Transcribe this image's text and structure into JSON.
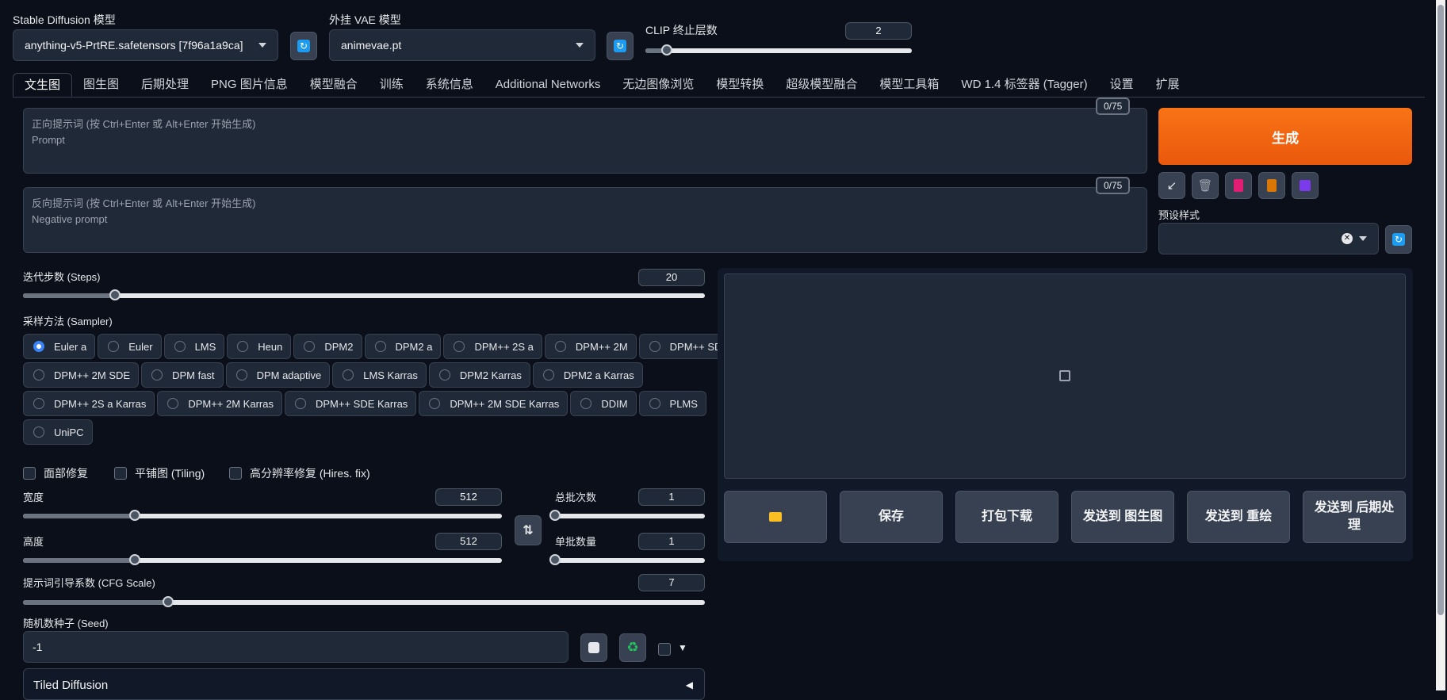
{
  "top": {
    "sd_model_label": "Stable Diffusion 模型",
    "sd_model_value": "anything-v5-PrtRE.safetensors [7f96a1a9ca]",
    "vae_label": "外挂 VAE 模型",
    "vae_value": "animevae.pt",
    "clip_label": "CLIP 终止层数",
    "clip_value": "2",
    "clip_fraction": 0.08
  },
  "tabs": [
    "文生图",
    "图生图",
    "后期处理",
    "PNG 图片信息",
    "模型融合",
    "训练",
    "系统信息",
    "Additional Networks",
    "无边图像浏览",
    "模型转换",
    "超级模型融合",
    "模型工具箱",
    "WD 1.4 标签器 (Tagger)",
    "设置",
    "扩展"
  ],
  "prompt": {
    "placeholder": "正向提示词 (按 Ctrl+Enter 或 Alt+Enter 开始生成)\nPrompt",
    "counter": "0/75"
  },
  "negative": {
    "placeholder": "反向提示词 (按 Ctrl+Enter 或 Alt+Enter 开始生成)\nNegative prompt",
    "counter": "0/75"
  },
  "generate_label": "生成",
  "tools": [
    "arrow-icon",
    "trash-icon",
    "card-icon",
    "clipboard-icon",
    "save-icon"
  ],
  "styles_label": "预设样式",
  "steps": {
    "label": "迭代步数 (Steps)",
    "value": "20",
    "fraction": 0.135
  },
  "sampler": {
    "label": "采样方法 (Sampler)",
    "rows": [
      [
        {
          "name": "Euler a",
          "checked": true
        },
        {
          "name": "Euler"
        },
        {
          "name": "LMS"
        },
        {
          "name": "Heun"
        },
        {
          "name": "DPM2"
        },
        {
          "name": "DPM2 a"
        },
        {
          "name": "DPM++ 2S a"
        },
        {
          "name": "DPM++ 2M"
        },
        {
          "name": "DPM++ SDE"
        }
      ],
      [
        {
          "name": "DPM++ 2M SDE"
        },
        {
          "name": "DPM fast"
        },
        {
          "name": "DPM adaptive"
        },
        {
          "name": "LMS Karras"
        },
        {
          "name": "DPM2 Karras"
        },
        {
          "name": "DPM2 a Karras"
        }
      ],
      [
        {
          "name": "DPM++ 2S a Karras"
        },
        {
          "name": "DPM++ 2M Karras"
        },
        {
          "name": "DPM++ SDE Karras"
        },
        {
          "name": "DPM++ 2M SDE Karras"
        },
        {
          "name": "DDIM"
        },
        {
          "name": "PLMS"
        }
      ],
      [
        {
          "name": "UniPC"
        }
      ]
    ]
  },
  "options": {
    "face_restore": "面部修复",
    "tiling": "平铺图 (Tiling)",
    "hires": "高分辨率修复 (Hires. fix)"
  },
  "width": {
    "label": "宽度",
    "value": "512",
    "fraction": 0.233
  },
  "height": {
    "label": "高度",
    "value": "512",
    "fraction": 0.233
  },
  "batch_count": {
    "label": "总批次数",
    "value": "1",
    "fraction": 0.0
  },
  "batch_size": {
    "label": "单批数量",
    "value": "1",
    "fraction": 0.0
  },
  "cfg": {
    "label": "提示词引导系数 (CFG Scale)",
    "value": "7",
    "fraction": 0.213
  },
  "seed": {
    "label": "随机数种子 (Seed)",
    "value": "-1"
  },
  "accordion_label": "Tiled Diffusion",
  "actions": [
    "保存",
    "打包下载",
    "发送到 图生图",
    "发送到 重绘",
    "发送到 后期处理"
  ]
}
